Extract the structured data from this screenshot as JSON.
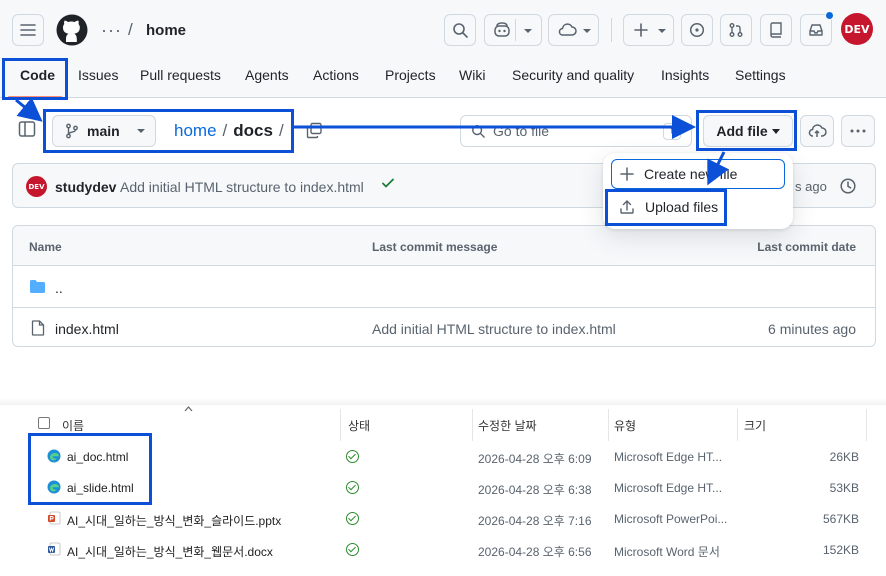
{
  "header": {
    "crumb_more": "···",
    "crumb_slash": "/",
    "crumb_repo": "home",
    "avatar_text": "DEV"
  },
  "repo_nav": {
    "items": [
      "Code",
      "Issues",
      "Pull requests",
      "Agents",
      "Actions",
      "Projects",
      "Wiki",
      "Security and quality",
      "Insights",
      "Settings"
    ]
  },
  "toolbar": {
    "branch": "main",
    "path": {
      "repo": "home",
      "sep": "/",
      "dir": "docs",
      "trail": "/"
    },
    "goto_placeholder": "Go to file",
    "goto_shortcut": "t",
    "add_file_label": "Add file"
  },
  "commit": {
    "user": "studydev",
    "message": "Add initial HTML structure to index.html",
    "time": "s ago"
  },
  "file_table": {
    "headers": {
      "name": "Name",
      "message": "Last commit message",
      "date": "Last commit date"
    },
    "rows": [
      {
        "name": "..",
        "message": "",
        "date": ""
      },
      {
        "name": "index.html",
        "message": "Add initial HTML structure to index.html",
        "date": "6 minutes ago"
      }
    ]
  },
  "dropdown": {
    "create": "Create new file",
    "upload": "Upload files"
  },
  "explorer": {
    "headers": {
      "name": "이름",
      "status": "상태",
      "modified": "수정한 날짜",
      "type": "유형",
      "size": "크기"
    },
    "rows": [
      {
        "name": "ai_doc.html",
        "modified": "2026-04-28 오후 6:09",
        "type": "Microsoft Edge HT...",
        "size": "26KB",
        "icon": "edge-icon"
      },
      {
        "name": "ai_slide.html",
        "modified": "2026-04-28 오후 6:38",
        "type": "Microsoft Edge HT...",
        "size": "53KB",
        "icon": "edge-icon"
      },
      {
        "name": "AI_시대_일하는_방식_변화_슬라이드.pptx",
        "modified": "2026-04-28 오후 7:16",
        "type": "Microsoft PowerPoi...",
        "size": "567KB",
        "icon": "powerpoint-icon"
      },
      {
        "name": "AI_시대_일하는_방식_변화_웹문서.docx",
        "modified": "2026-04-28 오후 6:56",
        "type": "Microsoft Word 문서",
        "size": "152KB",
        "icon": "word-icon"
      }
    ]
  },
  "colors": {
    "accent": "#0969da",
    "annotation": "#0b50d6",
    "tab_underline": "#fd8c73",
    "success": "#1a7f37",
    "avatar": "#c5162e"
  }
}
